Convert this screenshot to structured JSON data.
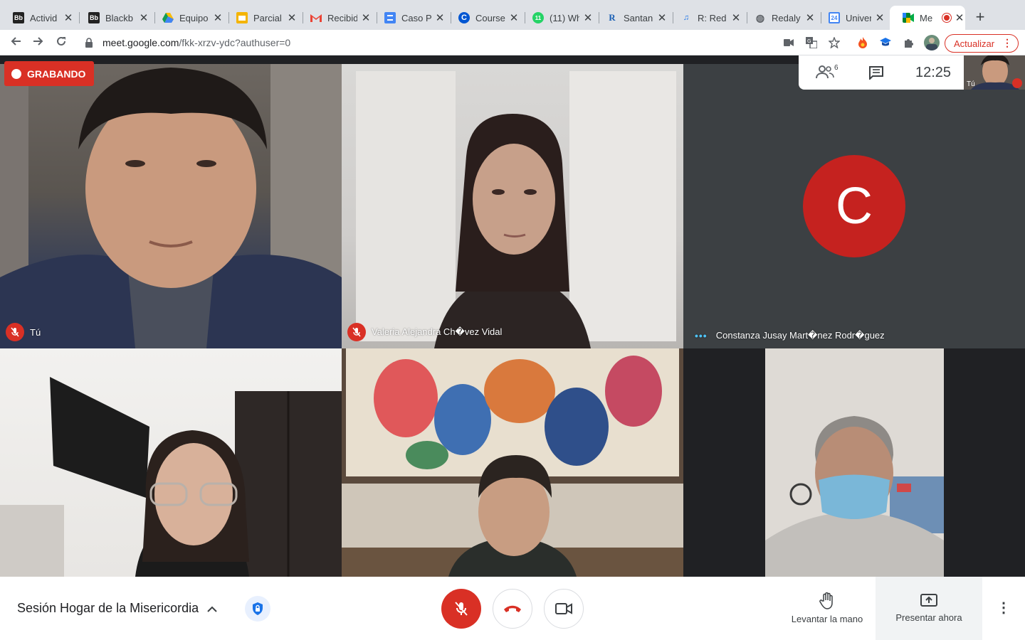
{
  "browser": {
    "tabs": [
      {
        "label": "Activid",
        "icon": "blackboard-icon",
        "close": "✕"
      },
      {
        "label": "Blackb",
        "icon": "blackboard-icon",
        "close": "✕"
      },
      {
        "label": "Equipo",
        "icon": "google-drive-icon",
        "close": "✕"
      },
      {
        "label": "Parcial",
        "icon": "google-slides-icon",
        "close": "✕"
      },
      {
        "label": "Recibid",
        "icon": "gmail-icon",
        "close": "✕"
      },
      {
        "label": "Caso P",
        "icon": "google-docs-icon",
        "close": "✕"
      },
      {
        "label": "Course",
        "icon": "coursera-icon",
        "close": "✕"
      },
      {
        "label": "(11) Wh",
        "icon": "whatsapp-icon",
        "close": "✕"
      },
      {
        "label": "Santan",
        "icon": "r-icon",
        "close": "✕"
      },
      {
        "label": "R: Red",
        "icon": "redaly-icon",
        "close": "✕"
      },
      {
        "label": "Redaly",
        "icon": "globe-icon",
        "close": "✕"
      },
      {
        "label": "Univer",
        "icon": "calendar-icon",
        "close": "✕"
      },
      {
        "label": "Me",
        "icon": "google-meet-icon",
        "close": "✕",
        "active": true
      }
    ],
    "url_host": "meet.google.com",
    "url_path": "/fkk-xrzv-ydc?authuser=0",
    "update_label": "Actualizar"
  },
  "meeting": {
    "recording_label": "GRABANDO",
    "participant_count": "6",
    "time": "12:25",
    "self_label": "Tú",
    "title": "Sesión Hogar de la Misericordia",
    "participants": [
      {
        "name": "Tú",
        "muted": true
      },
      {
        "name": "Valeria Alejandra Ch�vez Vidal",
        "muted": true
      },
      {
        "name": "Constanza Jusay Mart�nez Rodr�guez",
        "muted": false,
        "avatar_letter": "C",
        "avatar_color": "#c5221f"
      },
      {
        "name": "",
        "muted": false
      },
      {
        "name": "",
        "muted": false
      },
      {
        "name": "",
        "muted": false
      }
    ],
    "controls": {
      "raise_hand_label": "Levantar la mano",
      "present_label": "Presentar ahora"
    }
  },
  "colors": {
    "accent_red": "#d93025",
    "meet_bg": "#202124"
  }
}
